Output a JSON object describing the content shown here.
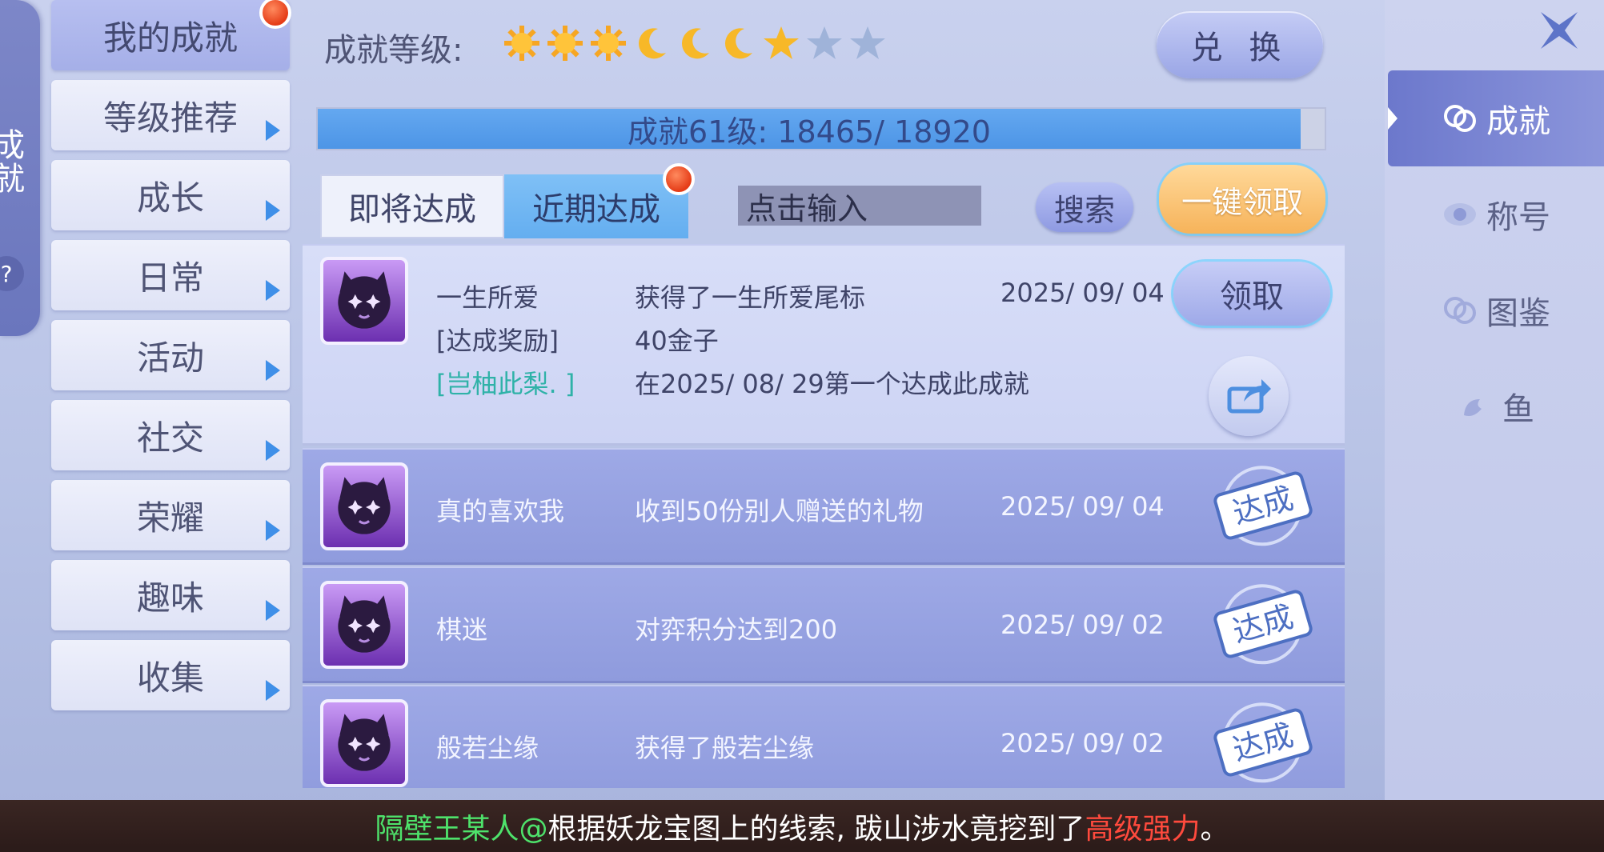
{
  "left_edge": {
    "vertical_text": "成就",
    "help": "?"
  },
  "categories": [
    {
      "label": "我的成就",
      "active": true,
      "badge": true
    },
    {
      "label": "等级推荐"
    },
    {
      "label": "成长"
    },
    {
      "label": "日常"
    },
    {
      "label": "活动"
    },
    {
      "label": "社交"
    },
    {
      "label": "荣耀"
    },
    {
      "label": "趣味"
    },
    {
      "label": "收集"
    }
  ],
  "header": {
    "level_label": "成就等级:",
    "stars": [
      "sun",
      "sun",
      "sun",
      "moon",
      "moon",
      "moon",
      "star",
      "star-empty",
      "star-empty"
    ],
    "exchange_label": "兑 换"
  },
  "progress": {
    "text": "成就61级: 18465/ 18920",
    "current": 18465,
    "max": 18920
  },
  "tabs": [
    {
      "label": "即将达成",
      "active": false
    },
    {
      "label": "近期达成",
      "active": true,
      "badge": true
    }
  ],
  "search": {
    "placeholder": "点击输入",
    "button_label": "搜索"
  },
  "claim_all_label": "一键领取",
  "achievements": [
    {
      "name": "一生所爱",
      "desc": "获得了一生所爱尾标",
      "date": "2025/ 09/ 04",
      "expanded": true,
      "reward_label": "[达成奖励]",
      "reward_value": "40金子",
      "first_player": "[岂柚此梨. ]",
      "first_note": "在2025/ 08/ 29第一个达成此成就",
      "claim_label": "领取"
    },
    {
      "name": "真的喜欢我",
      "desc": "收到50份别人赠送的礼物",
      "date": "2025/ 09/ 04",
      "stamp": "达成"
    },
    {
      "name": "棋迷",
      "desc": "对弈积分达到200",
      "date": "2025/ 09/ 02",
      "stamp": "达成"
    },
    {
      "name": "般若尘缘",
      "desc": "获得了般若尘缘",
      "date": "2025/ 09/ 02",
      "stamp": "达成"
    }
  ],
  "right_nav": [
    {
      "label": "成就",
      "icon": "achievement-icon",
      "active": true
    },
    {
      "label": "称号",
      "icon": "title-icon"
    },
    {
      "label": "图鉴",
      "icon": "codex-icon"
    },
    {
      "label": "鱼",
      "icon": "fish-icon"
    }
  ],
  "broadcast": {
    "player": "隔壁王某人@",
    "text": "根据妖龙宝图上的线索, 跋山涉水竟挖到了",
    "item": "高级强力",
    "end": "。"
  },
  "colors": {
    "accent_blue": "#4d95e6",
    "claim_orange": "#f6b35a",
    "badge_red": "#e53c17",
    "first_player_teal": "#2fb2a8"
  }
}
